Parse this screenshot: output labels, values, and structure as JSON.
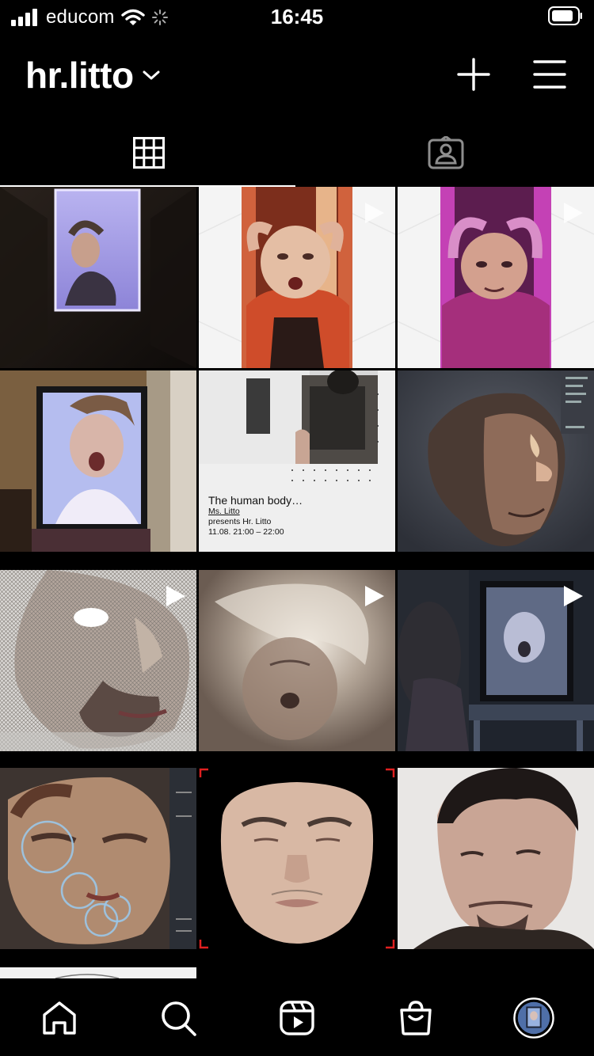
{
  "status_bar": {
    "carrier": "educom",
    "time": "16:45"
  },
  "header": {
    "username": "hr.litto",
    "icons": [
      "chevron-down-icon",
      "plus-icon",
      "menu-icon"
    ]
  },
  "tabs": [
    {
      "name": "grid",
      "icon": "grid-icon",
      "active": true
    },
    {
      "name": "tagged",
      "icon": "tagged-icon",
      "active": false
    }
  ],
  "post_text": {
    "title": "The human body…",
    "author": "Ms. Litto",
    "presents": "presents Hr. Litto",
    "datetime": "11.08. 21:00 – 22:00"
  },
  "posts": [
    {
      "id": 1,
      "reel": false
    },
    {
      "id": 2,
      "reel": true
    },
    {
      "id": 3,
      "reel": true
    },
    {
      "id": 4,
      "reel": false
    },
    {
      "id": 5,
      "reel": false
    },
    {
      "id": 6,
      "reel": false
    },
    {
      "id": 7,
      "reel": true
    },
    {
      "id": 8,
      "reel": true
    },
    {
      "id": 9,
      "reel": true
    },
    {
      "id": 10,
      "reel": false
    },
    {
      "id": 11,
      "reel": false
    },
    {
      "id": 12,
      "reel": false
    }
  ],
  "bottom_nav": [
    "home-icon",
    "search-icon",
    "reels-icon",
    "shop-icon",
    "profile-avatar"
  ],
  "colors": {
    "background": "#000000",
    "text": "#ffffff"
  }
}
